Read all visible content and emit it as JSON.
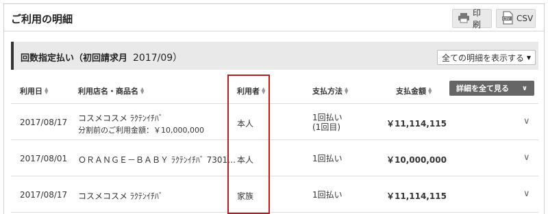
{
  "header": {
    "title": "ご利用の明細",
    "print_label": "印刷",
    "csv_label": "CSV"
  },
  "section": {
    "label": "回数指定払い（初回請求月",
    "month": "2017/09）",
    "filter_value": "全ての明細を表示する"
  },
  "table": {
    "columns": {
      "date": "利用日",
      "store": "利用店名・商品名",
      "user": "利用者",
      "method": "支払方法",
      "amount": "支払金額"
    },
    "detail_button": "詳細を全て見る",
    "rows": [
      {
        "date": "2017/08/17",
        "store": "コスメコスメ ﾗｸﾃﾝｲﾁﾊﾞ",
        "sub": "分割前のご利用金額：￥10,000,000",
        "user": "本人",
        "method": "1回払い",
        "method_sub": "(1回目)",
        "amount": "￥11,114,115"
      },
      {
        "date": "2017/08/01",
        "store": "ＯＲＡＮＧＥ－ＢＡＢＹ ﾗｸﾃﾝｲﾁﾊﾞ 7301…",
        "user": "本人",
        "method": "1回払い",
        "amount": "￥10,000,000"
      },
      {
        "date": "2017/08/17",
        "store": "コスメコスメ ﾗｸﾃﾝｲﾁﾊﾞ",
        "user": "家族",
        "method": "1回払い",
        "amount": "￥11,114,115"
      }
    ]
  },
  "icons": [
    "printer-icon",
    "csv-icon",
    "sort-icon",
    "chevron-down-icon"
  ],
  "colors": {
    "highlight": "#b81c22",
    "section_bg": "#e9e9e9",
    "detail_button_bg": "#666666"
  }
}
